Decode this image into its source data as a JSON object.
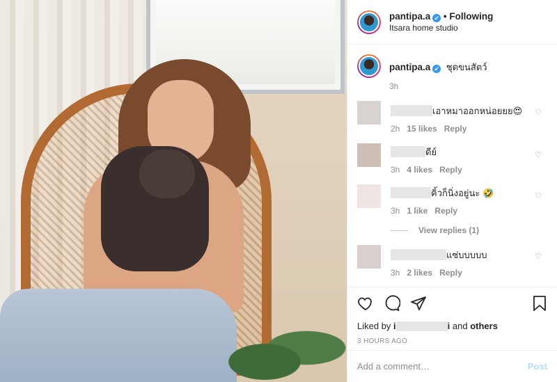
{
  "post": {
    "username": "pantipa.a",
    "verified_icon": "✔",
    "follow_status": "• Following",
    "location": "Itsara home studio"
  },
  "caption": {
    "username": "pantipa.a",
    "text": "ชุดขนสัตว์",
    "time": "3h"
  },
  "comments": [
    {
      "text": "เอาหมาออกหน่อยยย😍",
      "time": "2h",
      "likes": "15 likes",
      "reply": "Reply"
    },
    {
      "text": "ดีย์",
      "time": "3h",
      "likes": "4 likes",
      "reply": "Reply"
    },
    {
      "text": "คิ้วก็นิ่งอยู่นะ 🤣",
      "time": "3h",
      "likes": "1 like",
      "reply": "Reply"
    },
    {
      "text": "แซ่บบบบบ",
      "time": "3h",
      "likes": "2 likes",
      "reply": "Reply"
    }
  ],
  "view_replies": "View replies (1)",
  "likes": {
    "prefix": "Liked by ",
    "name_start": "i",
    "name_end": "i",
    "and": " and ",
    "others": "others"
  },
  "timestamp": "3 HOURS AGO",
  "add_comment": {
    "placeholder": "Add a comment…",
    "post_label": "Post"
  },
  "colors": {
    "verified": "#3897f0",
    "muted": "#8e8e8e",
    "post_disabled": "#b2dffc"
  },
  "icons": [
    "heart-icon",
    "comment-icon",
    "share-icon",
    "bookmark-icon",
    "like-comment-heart-icon"
  ]
}
